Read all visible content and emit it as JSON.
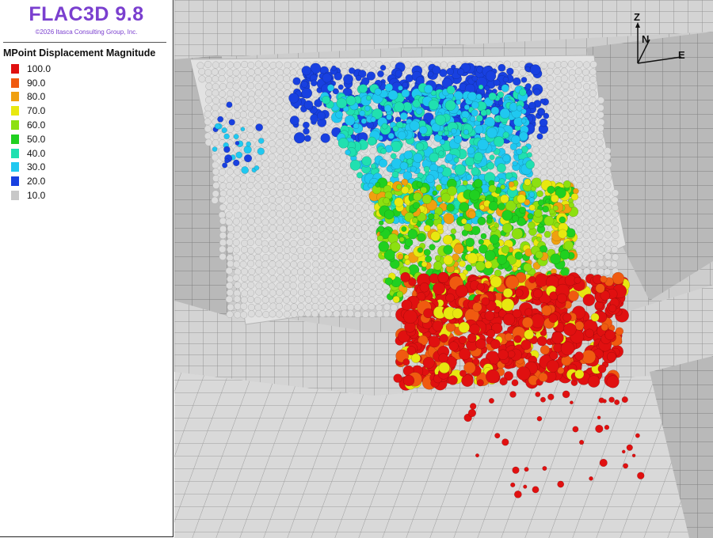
{
  "app": {
    "title": "FLAC3D 9.8",
    "copyright": "©2026 Itasca Consulting Group, Inc."
  },
  "legend": {
    "title": "MPoint Displacement Magnitude",
    "items": [
      {
        "label": "100.0",
        "color": "#e01010"
      },
      {
        "label": "90.0",
        "color": "#f05a10"
      },
      {
        "label": "80.0",
        "color": "#f0a010"
      },
      {
        "label": "70.0",
        "color": "#e8e810"
      },
      {
        "label": "60.0",
        "color": "#8ce010"
      },
      {
        "label": "50.0",
        "color": "#20d020"
      },
      {
        "label": "40.0",
        "color": "#20e0b0"
      },
      {
        "label": "30.0",
        "color": "#20c8f0"
      },
      {
        "label": "20.0",
        "color": "#1840e0"
      },
      {
        "label": "10.0",
        "color": "#c8c8c8"
      }
    ]
  },
  "axes": {
    "z": "Z",
    "n": "N",
    "e": "E"
  },
  "colors": {
    "brand": "#7a3fcf",
    "mesh_face": "#cfcfcf",
    "mesh_line": "#8a8a8a",
    "ball_gray": "#dcdcdc"
  }
}
